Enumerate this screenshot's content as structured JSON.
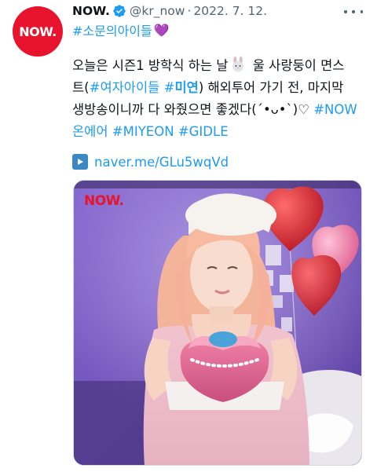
{
  "account": {
    "avatar_text": "NOW.",
    "display_name": "NOW.",
    "handle": "@kr_now",
    "separator": "·",
    "date": "2022. 7. 12."
  },
  "tweet": {
    "hashtag_line": "#소문의아이들",
    "heart_emoji": "💜",
    "lines": {
      "l1_a": "오늘은 시즌1 방학식 하는 날",
      "l1_b": " 울 사랑둥이 면스",
      "l2_a": "트(",
      "l2_tag1": "#여자아이들",
      "l2_sp": " ",
      "l2_tag2_prefix": "#",
      "l2_tag2_bold": "미연",
      "l2_b": ") 해외투어 가기 전, 마지막",
      "l3_a": "생방송이니까 다 와줬으면 좋겠다(´•ᴗ•`)♡ ",
      "l3_tag": "#NOW",
      "l4_tag1": "온에어",
      "l4_sp1": " ",
      "l4_tag2": "#MIYEON",
      "l4_sp2": " ",
      "l4_tag3": "#GIDLE"
    },
    "link_text": "naver.me/GLu5wqVd"
  },
  "media": {
    "watermark": "NOW."
  },
  "colors": {
    "brand_red": "#e8132c",
    "link_blue": "#1d9bf0",
    "verified_blue": "#1d9bf0",
    "text": "#0f1419",
    "muted": "#536471"
  },
  "icons": {
    "verified": "verified-badge-icon",
    "more": "more-options-icon",
    "bunny": "rabbit-face-icon",
    "play": "play-button-icon"
  }
}
